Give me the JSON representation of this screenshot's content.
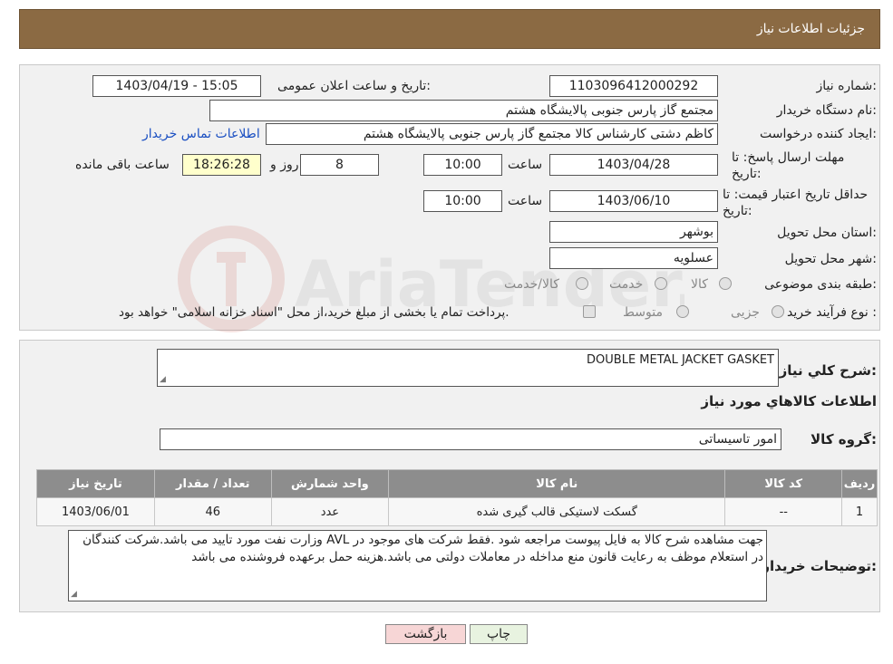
{
  "header": {
    "title": "جزئیات اطلاعات نیاز"
  },
  "form": {
    "need_number_label": "شماره نیاز:",
    "need_number": "1103096412000292",
    "announce_label": "تاریخ و ساعت اعلان عمومی:",
    "announce_value": "1403/04/19 - 15:05",
    "buyer_org_label": "نام دستگاه خریدار:",
    "buyer_org": "مجتمع گاز پارس جنوبی  پالایشگاه هشتم",
    "requester_label": "ایجاد کننده درخواست:",
    "requester": "کاظم دشتی کارشناس کالا مجتمع گاز پارس جنوبی  پالایشگاه هشتم",
    "contact_link": "اطلاعات تماس خریدار",
    "deadline_label": "مهلت ارسال پاسخ: تا تاریخ:",
    "deadline_date": "1403/04/28",
    "time_label": "ساعت",
    "deadline_time": "10:00",
    "days_value": "8",
    "days_label": "روز و",
    "remaining_time": "18:26:28",
    "remaining_label": "ساعت باقی مانده",
    "validity_label": "حداقل تاریخ اعتبار قیمت: تا تاریخ:",
    "validity_date": "1403/06/10",
    "validity_time": "10:00",
    "province_label": "استان محل تحویل:",
    "province": "بوشهر",
    "city_label": "شهر محل تحویل:",
    "city": "عسلویه",
    "category_label": "طبقه بندی موضوعی:",
    "category_options": [
      "کالا",
      "خدمت",
      "کالا/خدمت"
    ],
    "process_label": "نوع فرآیند خرید :",
    "process_options": [
      "جزیی",
      "متوسط"
    ],
    "process_note": "پرداخت تمام یا بخشی از مبلغ خرید،از محل \"اسناد خزانه اسلامی\" خواهد بود."
  },
  "details": {
    "summary_label": "شرح کلي نياز:",
    "summary_value": "DOUBLE METAL JACKET GASKET",
    "goods_info_title": "اطلاعات کالاهاي مورد نياز",
    "group_label": "گروه کالا:",
    "group_value": "امور تاسیساتی",
    "table": {
      "headers": [
        "ردیف",
        "کد کالا",
        "نام کالا",
        "واحد شمارش",
        "تعداد / مقدار",
        "تاریخ نیاز"
      ],
      "rows": [
        [
          "1",
          "--",
          "گسکت لاستیکی قالب گیری شده",
          "عدد",
          "46",
          "1403/06/01"
        ]
      ]
    },
    "buyer_notes_label": "توضیحات خریدار:",
    "buyer_notes": "جهت مشاهده شرح کالا به فایل پیوست مراجعه شود .فقط شرکت های موجود در AVL وزارت نفت مورد تایید می باشد.شرکت کنندگان در استعلام موظف به رعایت قانون منع مداخله در معاملات دولتی می باشد.هزینه حمل برعهده فروشنده می باشد"
  },
  "buttons": {
    "print": "چاپ",
    "back": "بازگشت"
  },
  "watermark": {
    "text": "AriaTender.neT"
  },
  "colors": {
    "header": "#8b6a43",
    "table_header": "#8d8d8d",
    "link": "#1a4fc2"
  }
}
